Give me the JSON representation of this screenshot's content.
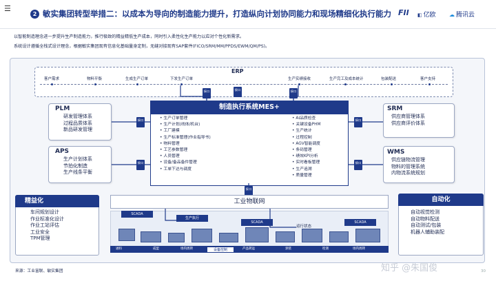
{
  "header": {
    "number": "2",
    "title": "敏实集团转型举措二：以成本为导向的制造能力提升，打造纵向计划协同能力和现场精细化执行能力",
    "logos": [
      "FII",
      "亿欧",
      "腾讯云"
    ]
  },
  "intro": [
    "以智能制造理念进一步提升生产制造能力，推行极致的精益精低生产成本，同时引入柔性化生产能力以应对个性化新需求。",
    "系统设计遵循全栈式设计理念，根据敏实集团现有信息化基础量身定制，无缝对接现有SAP套件(FICO/SRM/MM/PPDS/EWM/QM/PS)。"
  ],
  "erp": {
    "label": "ERP",
    "items": [
      "客户需求",
      "物料平衡",
      "生成生产订单",
      "下发生产订单",
      "生产实绩接收",
      "生产完工及成本统计",
      "包装配送",
      "客户支持"
    ]
  },
  "interface_label": "接口",
  "plm": {
    "title": "PLM",
    "lines": [
      "研发管理体系",
      "过程品质体系",
      "新品研发管理"
    ]
  },
  "aps": {
    "title": "APS",
    "lines": [
      "生产计划体系",
      "节拍化制造",
      "生产线条平衡"
    ]
  },
  "srm": {
    "title": "SRM",
    "lines": [
      "供应商管理体系",
      "供应商评价体系"
    ]
  },
  "wms": {
    "title": "WMS",
    "lines": [
      "供应链物流管理",
      "物料的管理系统",
      "内物流系统规划"
    ]
  },
  "mes": {
    "title": "制造执行系统MES+",
    "left": [
      "生产订单管理",
      "生产计划(线体/机台)",
      "工厂建模",
      "生产标准管理(作业指导书)",
      "物料管理",
      "工艺参数管理",
      "人员管理",
      "设备/备品备件管理",
      "工单下达与调度"
    ],
    "right": [
      "AI品质检查",
      "关键设备PHM",
      "生产统计",
      "过程控制",
      "AGV智能调度",
      "条码管理",
      "绩效KPI分析",
      "实时看板管理",
      "生产追溯",
      "质量管理"
    ]
  },
  "iot": {
    "label": "工业物联网"
  },
  "lean": {
    "title": "精益化",
    "lines": [
      "车间规划设计",
      "作业标准化设计",
      "作业工站评估",
      "工业安全",
      "TPM管理"
    ]
  },
  "automation": {
    "title": "自动化",
    "lines": [
      "自动视觉检测",
      "自动物料配送",
      "自动测试/包装",
      "机器人辅助装配"
    ]
  },
  "shop": {
    "scada": "SCADA",
    "exec": "生产执行",
    "run_status": "运行状态",
    "device_ctrl": "设备控制",
    "stages": [
      "进料",
      "成型",
      "场内周转",
      "装配",
      "产品转运",
      "涂装",
      "检测",
      "场内周转"
    ]
  },
  "footer": {
    "source": "来源：工业富联、敏实集团",
    "watermark": "知乎 @朱国俊",
    "page": "30"
  },
  "colors": {
    "primary": "#1f3a8a",
    "frame": "#f4f6fa"
  }
}
